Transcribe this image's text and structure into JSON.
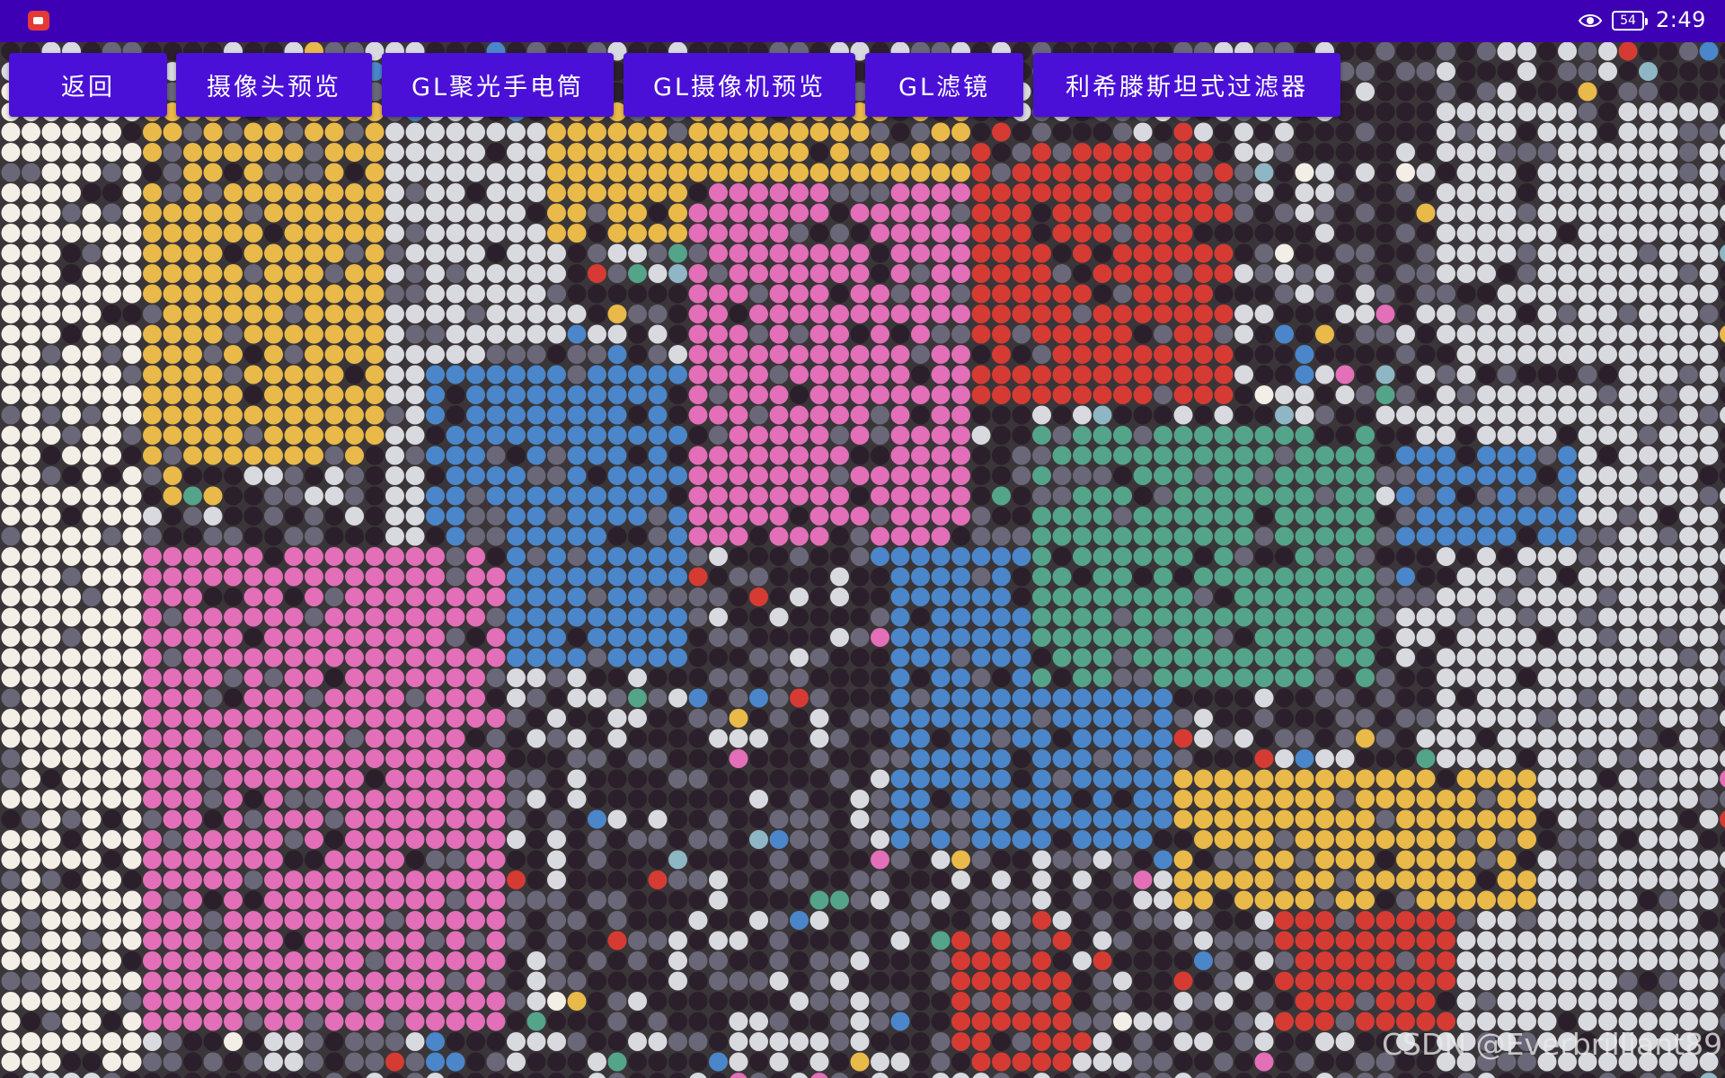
{
  "status_bar": {
    "app_icon": "screen-recorder-icon",
    "eye_icon": "eye-icon",
    "battery_level": "54",
    "time": "2:49",
    "background_color": "#3d00b5"
  },
  "buttons": [
    {
      "label": "返回",
      "name": "back-button"
    },
    {
      "label": "摄像头预览",
      "name": "camera-preview-button"
    },
    {
      "label": "GL聚光手电筒",
      "name": "gl-spotlight-flashlight-button"
    },
    {
      "label": "GL摄像机预览",
      "name": "gl-camera-preview-button"
    },
    {
      "label": "GL滤镜",
      "name": "gl-filter-button"
    },
    {
      "label": "利希滕斯坦式过滤器",
      "name": "lichtenstein-filter-button"
    }
  ],
  "button_color": "#4a10d8",
  "preview": {
    "description_icon": "halftone-dot-mosaic-camera-preview",
    "palette": [
      "#e9b949",
      "#4a86c9",
      "#e26fb8",
      "#54a48a",
      "#d63b33",
      "#d9d9e0",
      "#2a1f2a",
      "#6a6878",
      "#f3eee6",
      "#8fb6c4"
    ]
  },
  "watermark": "CSDN @Everbrilliant89"
}
